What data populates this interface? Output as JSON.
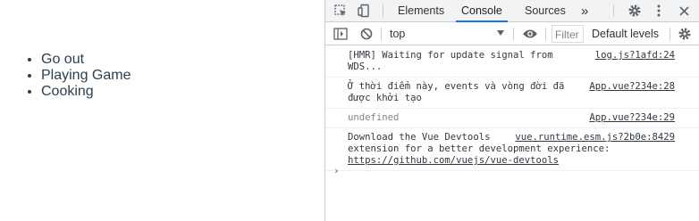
{
  "page": {
    "list_items": [
      "Go out",
      "Playing Game",
      "Cooking"
    ]
  },
  "devtools": {
    "tabs": [
      "Elements",
      "Console",
      "Sources"
    ],
    "active_tab": "Console",
    "more_tabs": "»",
    "context": "top",
    "filter_placeholder": "Filter",
    "default_levels": "Default levels",
    "messages": [
      {
        "text": "[HMR] Waiting for update signal from\nWDS...",
        "source": "log.js?1afd:24"
      },
      {
        "text": "Ở thời điểm này, events và vòng đời đã\nđược khởi tạo",
        "source": "App.vue?234e:28"
      },
      {
        "text": "undefined",
        "source": "App.vue?234e:29"
      },
      {
        "text": "Download the Vue Devtools\nextension for a better development experience:",
        "source": "vue.runtime.esm.js?2b0e:8429",
        "link": "https://github.com/vuejs/vue-devtools"
      }
    ],
    "prompt": "›"
  },
  "colors": {
    "accent": "#1a73e8",
    "list_text": "#2c3e50",
    "toolbar_bg": "#f1f3f4"
  }
}
